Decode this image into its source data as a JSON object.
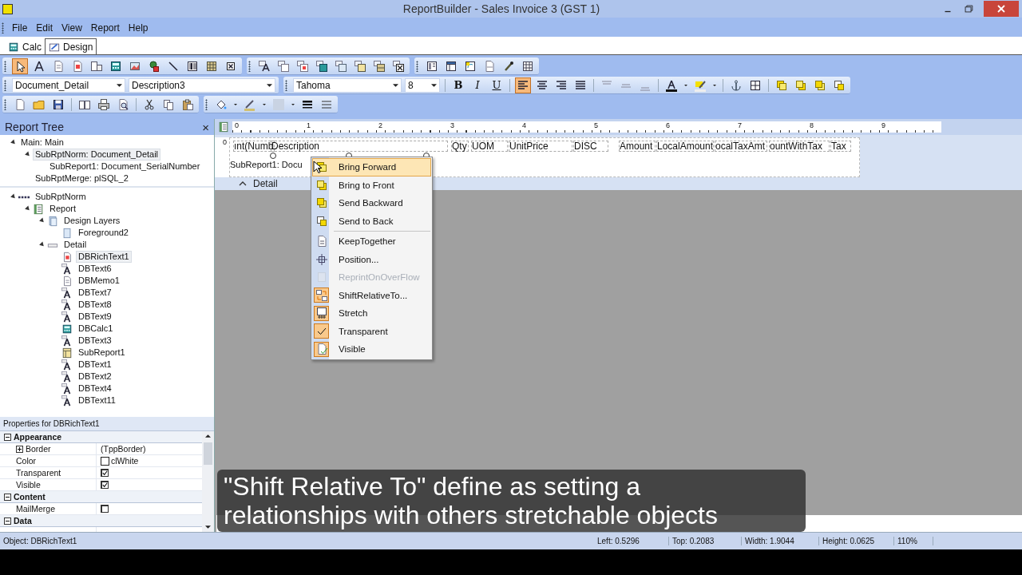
{
  "window": {
    "title": "ReportBuilder - Sales Invoice 3 (GST 1)"
  },
  "menu": [
    "File",
    "Edit",
    "View",
    "Report",
    "Help"
  ],
  "tabs": [
    {
      "label": "Calc",
      "kind": "calc",
      "selected": false
    },
    {
      "label": "Design",
      "kind": "design",
      "selected": true
    }
  ],
  "tools": [
    {
      "kind": "pointer",
      "selected": true
    },
    {
      "kind": "label",
      "selected": false
    },
    {
      "kind": "memo",
      "selected": false
    },
    {
      "kind": "richtext",
      "selected": false
    },
    {
      "kind": "variable",
      "selected": false
    },
    {
      "kind": "calc",
      "selected": false
    },
    {
      "kind": "image",
      "selected": false
    },
    {
      "kind": "shape",
      "selected": false
    },
    {
      "kind": "line",
      "selected": false
    },
    {
      "kind": "barcode",
      "selected": false
    },
    {
      "kind": "matrix",
      "selected": false
    },
    {
      "kind": "xbox",
      "selected": false
    }
  ],
  "format_bar": {
    "band": "Document_Detail",
    "field": "Description3",
    "font": "Tahoma",
    "size": "8",
    "bold": "B",
    "italic": "I",
    "underline": "U",
    "alignment": [
      {
        "kind": "left",
        "selected": true
      },
      {
        "kind": "center",
        "selected": false
      },
      {
        "kind": "right",
        "selected": false
      },
      {
        "kind": "justify",
        "selected": false
      }
    ]
  },
  "report_tree": {
    "title": "Report Tree",
    "close": "×",
    "outline": [
      {
        "label": "Main: Main",
        "expanded": true,
        "selected": false,
        "children": [
          {
            "label": "SubRptNorm: Document_Detail",
            "expanded": true,
            "selected": true,
            "children": [
              {
                "label": "SubReport1: Document_SerialNumber",
                "expanded": false,
                "selected": false
              }
            ]
          },
          {
            "label": "SubRptMerge: plSQL_2",
            "expanded": false,
            "selected": false
          }
        ]
      }
    ],
    "components": [
      {
        "label": "SubRptNorm",
        "kind": "dots",
        "expanded": true,
        "selected": false,
        "children": [
          {
            "label": "Report",
            "kind": "report",
            "expanded": true,
            "selected": false,
            "children": [
              {
                "label": "Design Layers",
                "kind": "layers",
                "expanded": true,
                "selected": false,
                "children": [
                  {
                    "label": "Foreground2",
                    "kind": "layer",
                    "expanded": false,
                    "selected": false
                  }
                ]
              },
              {
                "label": "Detail",
                "kind": "band",
                "expanded": true,
                "selected": false,
                "children": [
                  {
                    "label": "DBRichText1",
                    "kind": "richtext",
                    "expanded": false,
                    "selected": true
                  },
                  {
                    "label": "DBText6",
                    "kind": "text",
                    "expanded": false,
                    "selected": false
                  },
                  {
                    "label": "DBMemo1",
                    "kind": "memo",
                    "expanded": false,
                    "selected": false
                  },
                  {
                    "label": "DBText7",
                    "kind": "text",
                    "expanded": false,
                    "selected": false
                  },
                  {
                    "label": "DBText8",
                    "kind": "text",
                    "expanded": false,
                    "selected": false
                  },
                  {
                    "label": "DBText9",
                    "kind": "text",
                    "expanded": false,
                    "selected": false
                  },
                  {
                    "label": "DBCalc1",
                    "kind": "calc",
                    "expanded": false,
                    "selected": false
                  },
                  {
                    "label": "DBText3",
                    "kind": "text",
                    "expanded": false,
                    "selected": false
                  },
                  {
                    "label": "SubReport1",
                    "kind": "subreport",
                    "expanded": false,
                    "selected": false
                  },
                  {
                    "label": "DBText1",
                    "kind": "text",
                    "expanded": false,
                    "selected": false
                  },
                  {
                    "label": "DBText2",
                    "kind": "text",
                    "expanded": false,
                    "selected": false
                  },
                  {
                    "label": "DBText4",
                    "kind": "text",
                    "expanded": false,
                    "selected": false
                  },
                  {
                    "label": "DBText11",
                    "kind": "text",
                    "expanded": false,
                    "selected": false
                  }
                ]
              }
            ]
          }
        ]
      }
    ]
  },
  "properties": {
    "title": "Properties for DBRichText1",
    "categories": [
      {
        "label": "Appearance",
        "expanded": true,
        "rows": [
          {
            "name": "Border",
            "kind": "expandable",
            "value": "(TppBorder)"
          },
          {
            "name": "Color",
            "kind": "color",
            "value": "clWhite"
          },
          {
            "name": "Transparent",
            "kind": "check",
            "checked": true
          },
          {
            "name": "Visible",
            "kind": "check",
            "checked": true
          }
        ]
      },
      {
        "label": "Content",
        "expanded": true,
        "rows": [
          {
            "name": "MailMerge",
            "kind": "check",
            "checked": false
          }
        ]
      },
      {
        "label": "Data",
        "expanded": true
      }
    ]
  },
  "designer": {
    "ruler": [
      "0",
      "1",
      "2",
      "3",
      "4",
      "5",
      "6",
      "7",
      "8",
      "9"
    ],
    "vertical_ruler": "0",
    "fields": [
      "ınt(Numb",
      "Description",
      "Qty",
      "UOM",
      "UnitPrice",
      "DISC",
      "Amount",
      "LocalAmount",
      "ocalTaxAmt",
      "ountWithTax",
      "Tax"
    ],
    "subreport": "SubReport1: Docu",
    "band": "Detail"
  },
  "context_menu": {
    "groups": [
      [
        {
          "label": "Bring Forward",
          "kind": "forward",
          "selected": true,
          "disabled": false,
          "checked": false
        },
        {
          "label": "Bring to Front",
          "kind": "front",
          "selected": false,
          "disabled": false,
          "checked": false
        },
        {
          "label": "Send Backward",
          "kind": "backward",
          "selected": false,
          "disabled": false,
          "checked": false
        },
        {
          "label": "Send to Back",
          "kind": "back",
          "selected": false,
          "disabled": false,
          "checked": false
        }
      ],
      [
        {
          "label": "KeepTogether",
          "kind": "keep",
          "selected": false,
          "disabled": false,
          "checked": false
        },
        {
          "label": "Position...",
          "kind": "position",
          "selected": false,
          "disabled": false,
          "checked": false
        },
        {
          "label": "ReprintOnOverFlow",
          "kind": "reprint",
          "selected": false,
          "disabled": true,
          "checked": false
        },
        {
          "label": "ShiftRelativeTo...",
          "kind": "shift",
          "selected": false,
          "disabled": false,
          "checked": true
        },
        {
          "label": "Stretch",
          "kind": "stretch",
          "selected": false,
          "disabled": false,
          "checked": true
        },
        {
          "label": "Transparent",
          "kind": "tick",
          "selected": false,
          "disabled": false,
          "checked": true
        },
        {
          "label": "Visible",
          "kind": "visible",
          "selected": false,
          "disabled": false,
          "checked": true
        }
      ]
    ]
  },
  "caption": "\"Shift Relative To\" define as setting a\nrelationships with others stretchable objects",
  "status_bar": {
    "object": "Object: DBRichText1",
    "left": "Left: 0.5296",
    "top": "Top: 0.2083",
    "width": "Width: 1.9044",
    "height": "Height: 0.0625",
    "zoom": "110%"
  }
}
